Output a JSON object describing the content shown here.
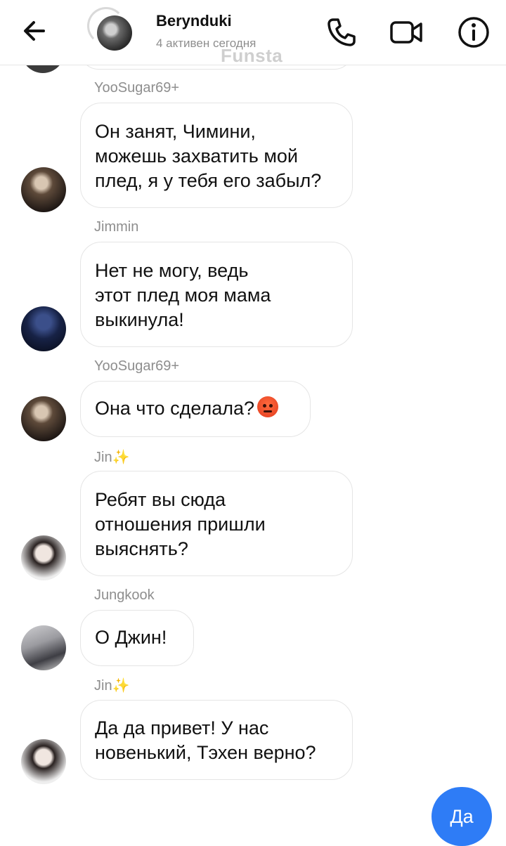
{
  "header": {
    "title": "Berynduki",
    "subtitle": "4 активен сегодня",
    "watermark": "Funsta"
  },
  "messages": [
    {
      "sender": "YooSugar69+",
      "lines": [
        "Он занят, Чимини,",
        "можешь захватить мой",
        "плед, я у тебя его забыл?"
      ]
    },
    {
      "sender": "Jimmin",
      "lines": [
        "Нет не могу, ведь",
        "этот плед моя мама",
        "выкинула!"
      ]
    },
    {
      "sender": "YooSugar69+",
      "lines": [
        "Она что сделала?"
      ],
      "emoji": "angry-face"
    },
    {
      "sender": "Jin",
      "sender_icon": "sparkles",
      "lines": [
        "Ребят вы сюда",
        "отношения пришли",
        "выяснять?"
      ]
    },
    {
      "sender": "Jungkook",
      "lines": [
        "О Джин!"
      ]
    },
    {
      "sender": "Jin",
      "sender_icon": "sparkles",
      "lines": [
        "Да да привет! У нас",
        "новенький, Тэхен верно?"
      ]
    }
  ],
  "sent": {
    "text": "Да"
  },
  "colors": {
    "accent": "#2e7cf6",
    "bubble_border": "#e5e5e5",
    "muted_text": "#8e8e8e"
  }
}
